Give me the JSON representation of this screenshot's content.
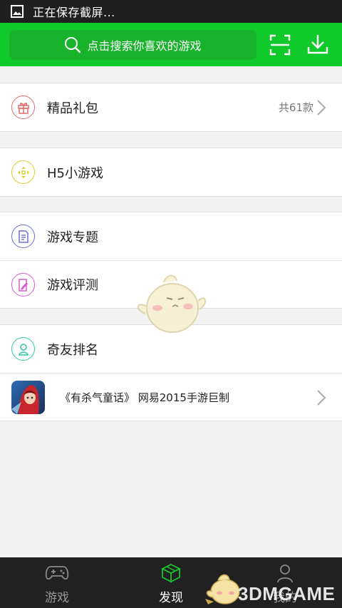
{
  "status_bar": {
    "text": "正在保存截屏..."
  },
  "header": {
    "search_placeholder": "点击搜索你喜欢的游戏",
    "scan_icon": "scan-icon",
    "download_icon": "download-icon"
  },
  "groups": {
    "gift": {
      "label": "精品礼包",
      "count": "共61款",
      "color": "#e06b6b"
    },
    "h5": {
      "label": "H5小游戏",
      "color": "#d8cd2a"
    },
    "topics": {
      "label": "游戏专题",
      "color": "#6b6fd6"
    },
    "reviews": {
      "label": "游戏评测",
      "color": "#d95ad2"
    },
    "ranking": {
      "label": "奇友排名",
      "color": "#2fc6a3"
    },
    "promo": {
      "label": "《有杀气童话》 网易2015手游巨制"
    }
  },
  "tab_bar": {
    "tabs": [
      {
        "label": "游戏",
        "icon": "gamepad-icon",
        "active": false
      },
      {
        "label": "发现",
        "icon": "cube-icon",
        "active": true
      },
      {
        "label": "我的",
        "icon": "person-icon",
        "active": false
      }
    ]
  },
  "watermark": {
    "text": "3DMGAME"
  }
}
